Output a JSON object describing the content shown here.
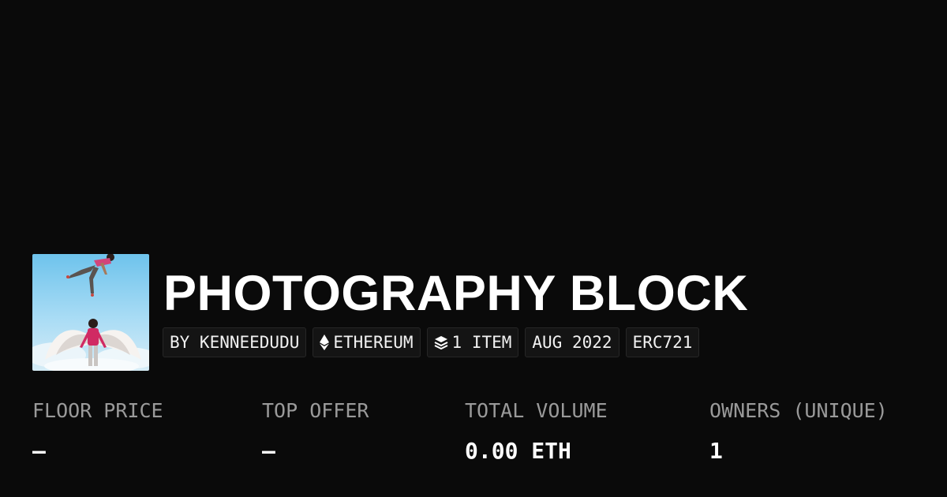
{
  "collection": {
    "title": "PHOTOGRAPHY BLOCK",
    "thumbnail_icon": "collection-photo-thumbnail"
  },
  "tags": {
    "creator": "BY KENNEEDUDU",
    "chain": {
      "label": "ETHEREUM",
      "icon": "ethereum-icon"
    },
    "items": {
      "label": "1 ITEM",
      "icon": "layers-icon"
    },
    "date": "AUG 2022",
    "standard": "ERC721"
  },
  "stats": {
    "floor_price": {
      "label": "FLOOR PRICE",
      "value": "—"
    },
    "top_offer": {
      "label": "TOP OFFER",
      "value": "—"
    },
    "total_volume": {
      "label": "TOTAL VOLUME",
      "value": "0.00 ETH"
    },
    "owners": {
      "label": "OWNERS (UNIQUE)",
      "value": "1"
    }
  },
  "colors": {
    "background": "#0a0a0a",
    "tag_background": "#141414",
    "label": "#9a9a9a",
    "text": "#ffffff"
  }
}
